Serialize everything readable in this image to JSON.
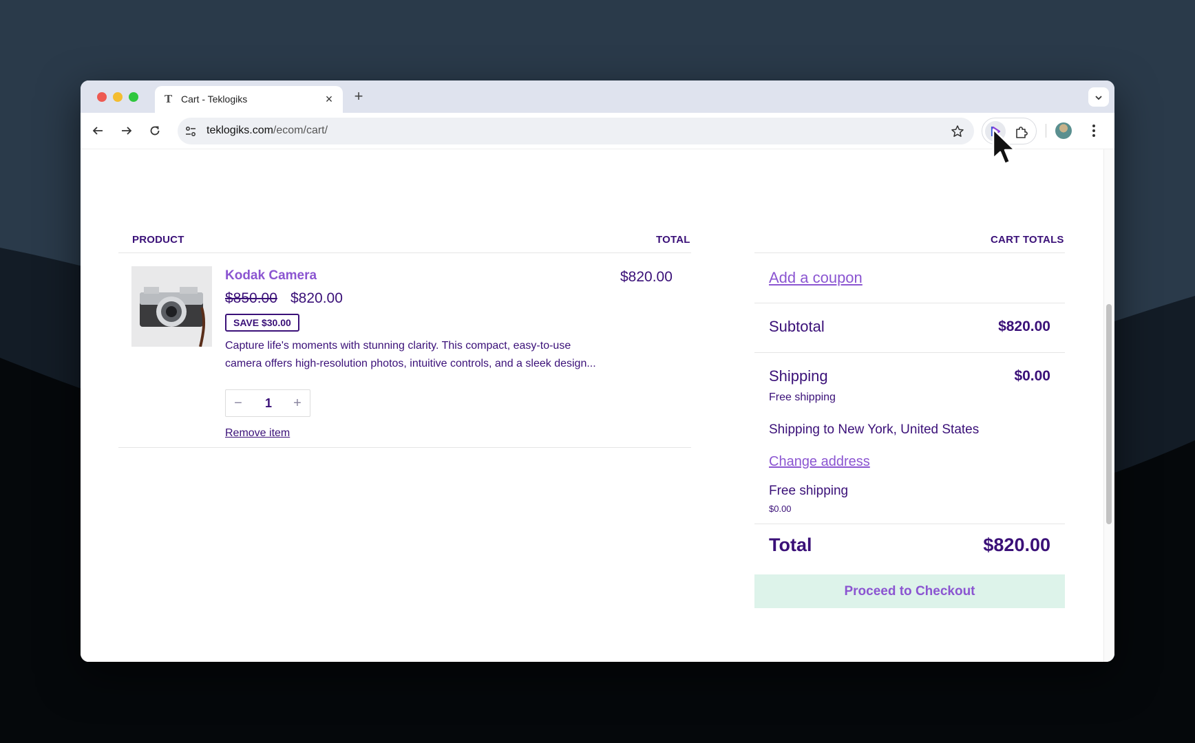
{
  "browser": {
    "tab_title": "Cart - Teklogiks",
    "tab_favicon": "T",
    "url_domain": "teklogiks.com",
    "url_path": "/ecom/cart/"
  },
  "cart": {
    "col_product": "PRODUCT",
    "col_total": "TOTAL",
    "item": {
      "name": "Kodak Camera",
      "price_old": "$850.00",
      "price_new": "$820.00",
      "badge": "SAVE $30.00",
      "description": "Capture life's moments with stunning clarity. This compact, easy-to-use camera offers high-resolution photos, intuitive controls, and a sleek design...",
      "quantity": "1",
      "remove_label": "Remove item",
      "line_total": "$820.00"
    }
  },
  "totals": {
    "heading": "CART TOTALS",
    "coupon_label": "Add a coupon",
    "subtotal_label": "Subtotal",
    "subtotal_value": "$820.00",
    "shipping_label": "Shipping",
    "shipping_value": "$0.00",
    "shipping_method": "Free shipping",
    "shipping_to": "Shipping to New York, United States",
    "change_address": "Change address",
    "option_label": "Free shipping",
    "option_price": "$0.00",
    "total_label": "Total",
    "total_value": "$820.00",
    "checkout_label": "Proceed to Checkout"
  },
  "colors": {
    "brand_text": "#3a1078",
    "link_accent": "#8b55d1",
    "checkout_bg": "#ddf3ea"
  }
}
